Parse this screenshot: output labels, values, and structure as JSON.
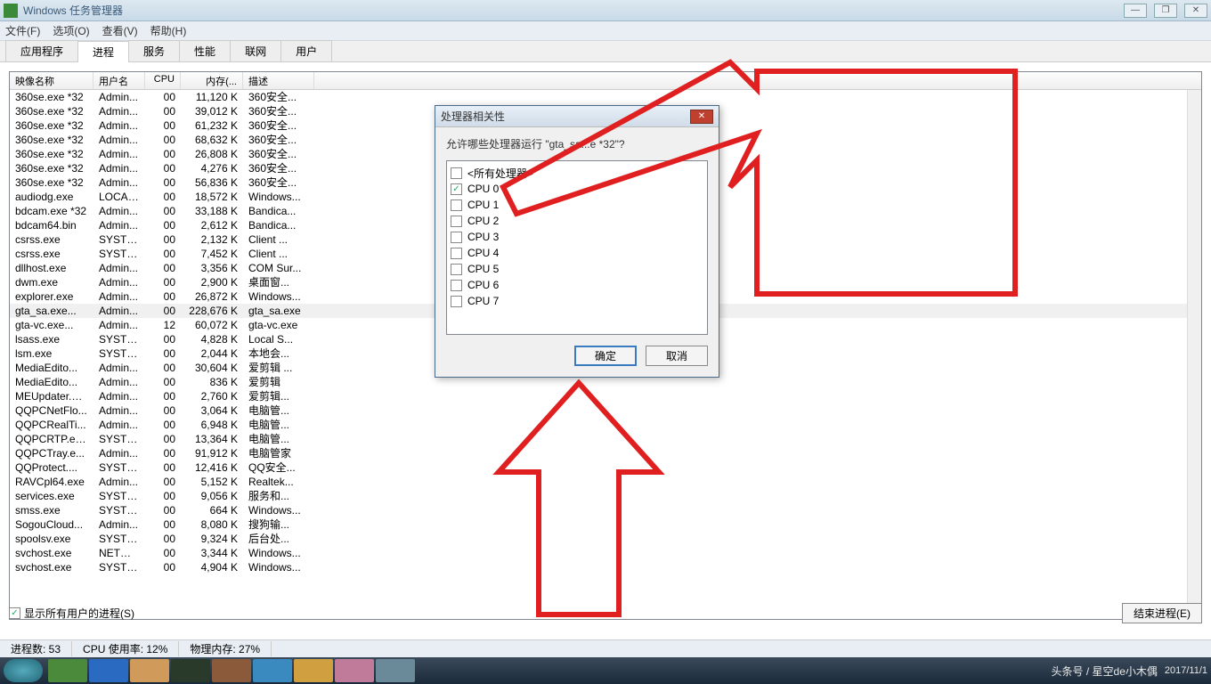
{
  "window": {
    "title": "Windows 任务管理器",
    "min": "—",
    "max": "❐",
    "close": "✕"
  },
  "menu": [
    "文件(F)",
    "选项(O)",
    "查看(V)",
    "帮助(H)"
  ],
  "tabs": [
    "应用程序",
    "进程",
    "服务",
    "性能",
    "联网",
    "用户"
  ],
  "cols": [
    "映像名称",
    "用户名",
    "CPU",
    "内存(...",
    "描述"
  ],
  "rows": [
    [
      "360se.exe *32",
      "Admin...",
      "00",
      "11,120 K",
      "360安全..."
    ],
    [
      "360se.exe *32",
      "Admin...",
      "00",
      "39,012 K",
      "360安全..."
    ],
    [
      "360se.exe *32",
      "Admin...",
      "00",
      "61,232 K",
      "360安全..."
    ],
    [
      "360se.exe *32",
      "Admin...",
      "00",
      "68,632 K",
      "360安全..."
    ],
    [
      "360se.exe *32",
      "Admin...",
      "00",
      "26,808 K",
      "360安全..."
    ],
    [
      "360se.exe *32",
      "Admin...",
      "00",
      "4,276 K",
      "360安全..."
    ],
    [
      "360se.exe *32",
      "Admin...",
      "00",
      "56,836 K",
      "360安全..."
    ],
    [
      "audiodg.exe",
      "LOCAL...",
      "00",
      "18,572 K",
      "Windows..."
    ],
    [
      "bdcam.exe *32",
      "Admin...",
      "00",
      "33,188 K",
      "Bandica..."
    ],
    [
      "bdcam64.bin",
      "Admin...",
      "00",
      "2,612 K",
      "Bandica..."
    ],
    [
      "csrss.exe",
      "SYSTEM",
      "00",
      "2,132 K",
      "Client ..."
    ],
    [
      "csrss.exe",
      "SYSTEM",
      "00",
      "7,452 K",
      "Client ..."
    ],
    [
      "dllhost.exe",
      "Admin...",
      "00",
      "3,356 K",
      "COM Sur..."
    ],
    [
      "dwm.exe",
      "Admin...",
      "00",
      "2,900 K",
      "桌面窗..."
    ],
    [
      "explorer.exe",
      "Admin...",
      "00",
      "26,872 K",
      "Windows..."
    ],
    [
      "gta_sa.exe...",
      "Admin...",
      "00",
      "228,676 K",
      "gta_sa.exe"
    ],
    [
      "gta-vc.exe...",
      "Admin...",
      "12",
      "60,072 K",
      "gta-vc.exe"
    ],
    [
      "lsass.exe",
      "SYSTEM",
      "00",
      "4,828 K",
      "Local S..."
    ],
    [
      "lsm.exe",
      "SYSTEM",
      "00",
      "2,044 K",
      "本地会..."
    ],
    [
      "MediaEdito...",
      "Admin...",
      "00",
      "30,604 K",
      "爱剪辑 ..."
    ],
    [
      "MediaEdito...",
      "Admin...",
      "00",
      "836 K",
      "爱剪辑"
    ],
    [
      "MEUpdater.exe",
      "Admin...",
      "00",
      "2,760 K",
      "爱剪辑..."
    ],
    [
      "QQPCNetFlo...",
      "Admin...",
      "00",
      "3,064 K",
      "电脑管..."
    ],
    [
      "QQPCRealTi...",
      "Admin...",
      "00",
      "6,948 K",
      "电脑管..."
    ],
    [
      "QQPCRTP.ex...",
      "SYSTEM",
      "00",
      "13,364 K",
      "电脑管..."
    ],
    [
      "QQPCTray.e...",
      "Admin...",
      "00",
      "91,912 K",
      "电脑管家"
    ],
    [
      "QQProtect....",
      "SYSTEM",
      "00",
      "12,416 K",
      "QQ安全..."
    ],
    [
      "RAVCpl64.exe",
      "Admin...",
      "00",
      "5,152 K",
      "Realtek..."
    ],
    [
      "services.exe",
      "SYSTEM",
      "00",
      "9,056 K",
      "服务和..."
    ],
    [
      "smss.exe",
      "SYSTEM",
      "00",
      "664 K",
      "Windows..."
    ],
    [
      "SogouCloud...",
      "Admin...",
      "00",
      "8,080 K",
      "搜狗输..."
    ],
    [
      "spoolsv.exe",
      "SYSTEM",
      "00",
      "9,324 K",
      "后台处..."
    ],
    [
      "svchost.exe",
      "NETWO...",
      "00",
      "3,344 K",
      "Windows..."
    ],
    [
      "svchost.exe",
      "SYSTEM",
      "00",
      "4,904 K",
      "Windows..."
    ]
  ],
  "selRow": 15,
  "showAll": "显示所有用户的进程(S)",
  "endproc": "结束进程(E)",
  "status": {
    "procs": "进程数: 53",
    "cpu": "CPU 使用率: 12%",
    "mem": "物理内存: 27%"
  },
  "dialog": {
    "title": "处理器相关性",
    "q": "允许哪些处理器运行 \"gta_sa...e *32\"?",
    "all": "<所有处理器>",
    "cpus": [
      "CPU 0",
      "CPU 1",
      "CPU 2",
      "CPU 3",
      "CPU 4",
      "CPU 5",
      "CPU 6",
      "CPU 7"
    ],
    "checked": 0,
    "ok": "确定",
    "cancel": "取消"
  },
  "watermark": "头条号 / 星空de小木偶",
  "date": "2017/11/1"
}
